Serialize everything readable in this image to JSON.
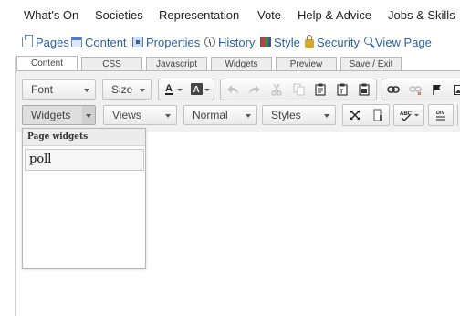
{
  "topnav": {
    "items": [
      "What's On",
      "Societies",
      "Representation",
      "Vote",
      "Help & Advice",
      "Jobs & Skills"
    ]
  },
  "editlinks": {
    "items": [
      {
        "label": "Pages",
        "icon": "pages-icon"
      },
      {
        "label": "Content",
        "icon": "content-icon"
      },
      {
        "label": "Properties",
        "icon": "properties-icon"
      },
      {
        "label": "History",
        "icon": "history-icon"
      },
      {
        "label": "Style",
        "icon": "style-icon"
      },
      {
        "label": "Security",
        "icon": "security-icon"
      },
      {
        "label": "View Page",
        "icon": "view-page-icon"
      }
    ]
  },
  "tabs": [
    "Content",
    "CSS",
    "Javascript",
    "Widgets",
    "Preview",
    "Save / Exit"
  ],
  "active_tab": "Content",
  "toolbar": {
    "font": "Font",
    "size": "Size",
    "widgets": "Widgets",
    "views": "Views",
    "format": "Normal",
    "styles": "Styles"
  },
  "widget_panel": {
    "title": "Page widgets",
    "items": [
      "poll"
    ]
  },
  "colors": {
    "link": "#2a62a8",
    "toolbar_bg": "#f1f1f1"
  }
}
